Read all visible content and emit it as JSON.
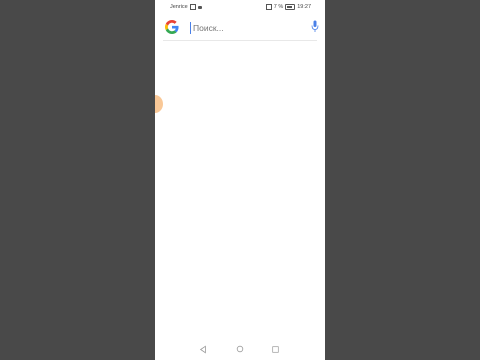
{
  "status_bar": {
    "carrier": "Jenrice",
    "battery_percent": "7 %",
    "time": "19:27"
  },
  "search": {
    "placeholder": "Поиск..."
  },
  "icons": {
    "logo": "google-logo-icon",
    "mic": "microphone-icon",
    "nav": [
      "back-icon",
      "home-icon",
      "recent-apps-icon"
    ]
  },
  "colors": {
    "background": "#494949",
    "screen": "#ffffff",
    "mic": "#4a80e8",
    "edge_handle": "#f8c28c"
  }
}
